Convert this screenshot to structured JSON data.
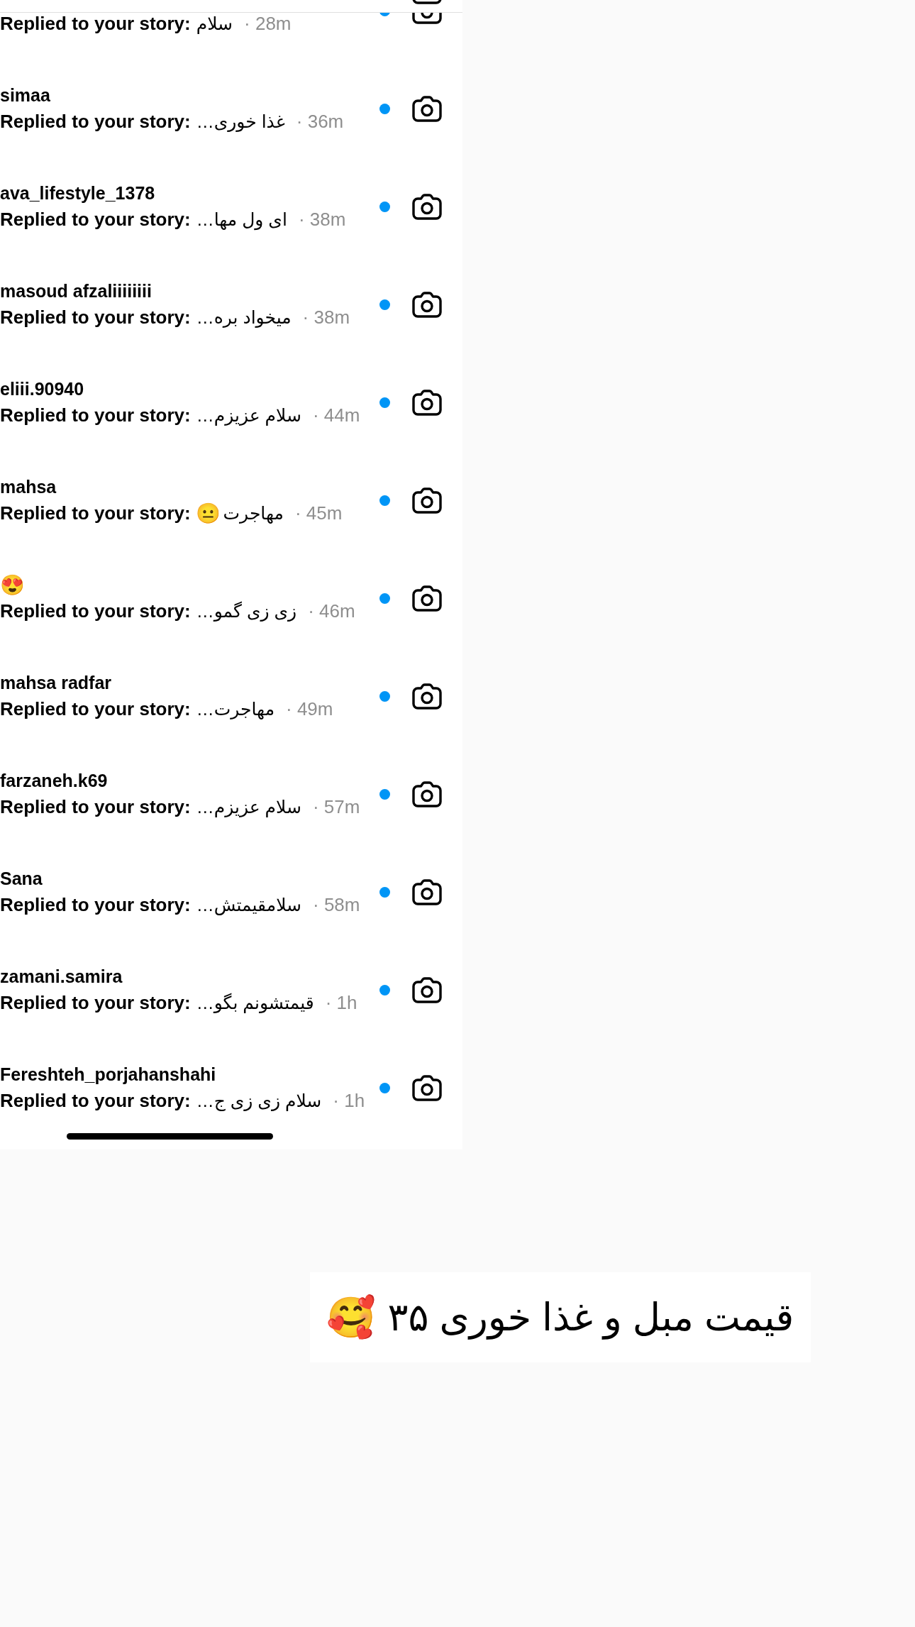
{
  "rows": [
    {
      "label": "Replied to your story:",
      "reply": "سلام",
      "time": "· 28m",
      "unread": true
    },
    {
      "name": "simaa",
      "label": "Replied to your story:",
      "reply": "غذا خوری…",
      "time": "· 36m",
      "unread": true
    },
    {
      "name": "ava_lifestyle_1378",
      "label": "Replied to your story:",
      "reply": "ای ول مها…",
      "time": "· 38m",
      "unread": true
    },
    {
      "name": "masoud afzaliiiiiiii",
      "label": "Replied to your story:",
      "reply": "میخواد بره…",
      "time": "· 38m",
      "unread": true
    },
    {
      "name": "eliii.90940",
      "label": "Replied to your story:",
      "reply": "سلام عزیزم…",
      "time": "· 44m",
      "unread": true
    },
    {
      "name": "mahsa",
      "label": "Replied to your story:",
      "reply": "مهاجرت",
      "reply_emoji": "😐",
      "time": "· 45m",
      "unread": true
    },
    {
      "name_emoji": "😍",
      "label": "Replied to your story:",
      "reply": "زی زی گمو…",
      "time": "· 46m",
      "unread": true
    },
    {
      "name": "mahsa radfar",
      "label": "Replied to your story:",
      "reply": "مهاجرت…",
      "time": "· 49m",
      "unread": true
    },
    {
      "name": "farzaneh.k69",
      "label": "Replied to your story:",
      "reply": "سلام عزیزم…",
      "time": "· 57m",
      "unread": true
    },
    {
      "name": "Sana",
      "label": "Replied to your story:",
      "reply": "سلامقیمتش…",
      "time": "· 58m",
      "unread": true
    },
    {
      "name": "zamani.samira",
      "label": "Replied to your story:",
      "reply": "قیمتشونم بگو…",
      "time": "· 1h",
      "unread": true
    },
    {
      "name": "Fereshteh_porjahanshahi",
      "label": "Replied to your story:",
      "reply": "سلام زی زی ج…",
      "time": "· 1h",
      "unread": true
    }
  ],
  "caption": {
    "text": "قیمت مبل و غذا خوری ۳۵",
    "emoji": "🥰"
  }
}
